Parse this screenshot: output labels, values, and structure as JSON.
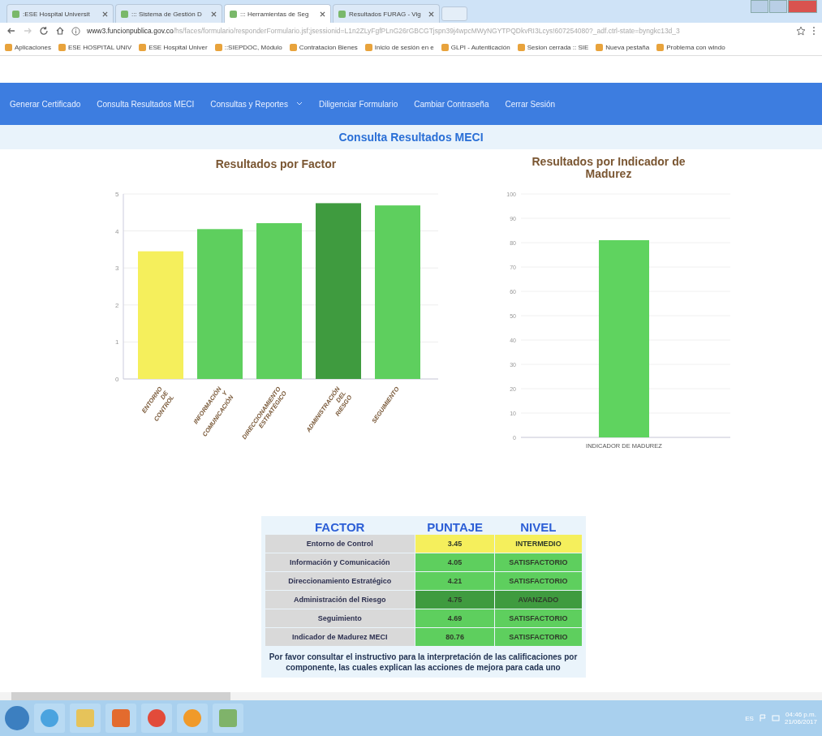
{
  "browser": {
    "tabs": [
      {
        "label": ":ESE Hospital Universit",
        "selected": false
      },
      {
        "label": "::: Sistema de Gestión D",
        "selected": false
      },
      {
        "label": "::: Herramientas de Seg",
        "selected": true
      },
      {
        "label": "Resultados FURAG - Vig",
        "selected": false
      }
    ],
    "url_host": "www3.funcionpublica.gov.co",
    "url_path": "/hs/faces/formulario/responderFormulario.jsf;jsessionid=L1n2ZLyFgfPLnG26rGBCGTjspn39j4wpcMWyNGYTPQDkvRI3Lcys!607254080?_adf.ctrl-state=byngkc13d_3",
    "bookmarks": [
      "Aplicaciones",
      "ESE HOSPITAL UNIV",
      "ESE Hospital Univer",
      "::SIEPDOC, Módulo",
      "Contratacion Bienes",
      "Inicio de sesión en e",
      "GLPI - Autenticación",
      "Sesion cerrada :: SIE",
      "Nueva pestaña",
      "Problema con windo"
    ]
  },
  "nav": [
    {
      "label": "Generar Certificado",
      "dropdown": false
    },
    {
      "label": "Consulta Resultados MECI",
      "dropdown": false
    },
    {
      "label": "Consultas y Reportes",
      "dropdown": true
    },
    {
      "label": "Diligenciar Formulario",
      "dropdown": false
    },
    {
      "label": "Cambiar Contraseña",
      "dropdown": false
    },
    {
      "label": "Cerrar Sesión",
      "dropdown": false
    }
  ],
  "page_title": "Consulta Resultados MECI",
  "charts": [
    {
      "chart_data": {
        "type": "bar",
        "title": "Resultados por Factor",
        "categories": [
          "ENTORNO DE CONTROL",
          "INFORMACIÓN Y COMUNICACIÓN",
          "DIRECCIONAMIENTO ESTRATÉGICO",
          "ADMINISTRACIÓN DEL RIESGO",
          "SEGUIMIENTO"
        ],
        "series": [
          {
            "values": [
              3.45,
              4.05,
              4.21,
              4.75,
              4.69
            ]
          }
        ],
        "grid": true,
        "ylim": [
          0,
          5
        ],
        "yticks": [
          0,
          1,
          2,
          3,
          4,
          5
        ]
      }
    },
    {
      "chart_data": {
        "type": "bar",
        "title": "Resultados por Indicador de Madurez",
        "categories": [
          "INDICADOR DE MADUREZ"
        ],
        "series": [
          {
            "color": "#5fd35f",
            "values": [
              81
            ]
          }
        ],
        "grid": true,
        "ylim": [
          0,
          100
        ],
        "yticks": [
          0,
          10,
          20,
          30,
          40,
          50,
          60,
          70,
          80,
          90,
          100
        ]
      }
    }
  ],
  "table": {
    "columns": [
      "FACTOR",
      "PUNTAJE",
      "NIVEL"
    ],
    "rows": [
      {
        "factor": "Entorno de Control",
        "puntaje": "3.45",
        "nivel": "INTERMEDIO",
        "color": "#f5ef5c"
      },
      {
        "factor": "Información y Comunicación",
        "puntaje": "4.05",
        "nivel": "SATISFACTORIO",
        "color": "#5ecf5e"
      },
      {
        "factor": "Direccionamiento Estratégico",
        "puntaje": "4.21",
        "nivel": "SATISFACTORIO",
        "color": "#5ecf5e"
      },
      {
        "factor": "Administración del Riesgo",
        "puntaje": "4.75",
        "nivel": "AVANZADO",
        "color": "#3f9b3f"
      },
      {
        "factor": "Seguimiento",
        "puntaje": "4.69",
        "nivel": "SATISFACTORIO",
        "color": "#5ecf5e"
      },
      {
        "factor": "Indicador de Madurez MECI",
        "puntaje": "80.76",
        "nivel": "SATISFACTORIO",
        "color": "#5ecf5e"
      }
    ],
    "note": "Por favor consultar el instructivo para la interpretación de las calificaciones por componente, las cuales explican las acciones de mejora para cada uno"
  },
  "taskbar": {
    "language": "ES",
    "time": "04:46 p.m.",
    "date": "21/06/2017"
  }
}
